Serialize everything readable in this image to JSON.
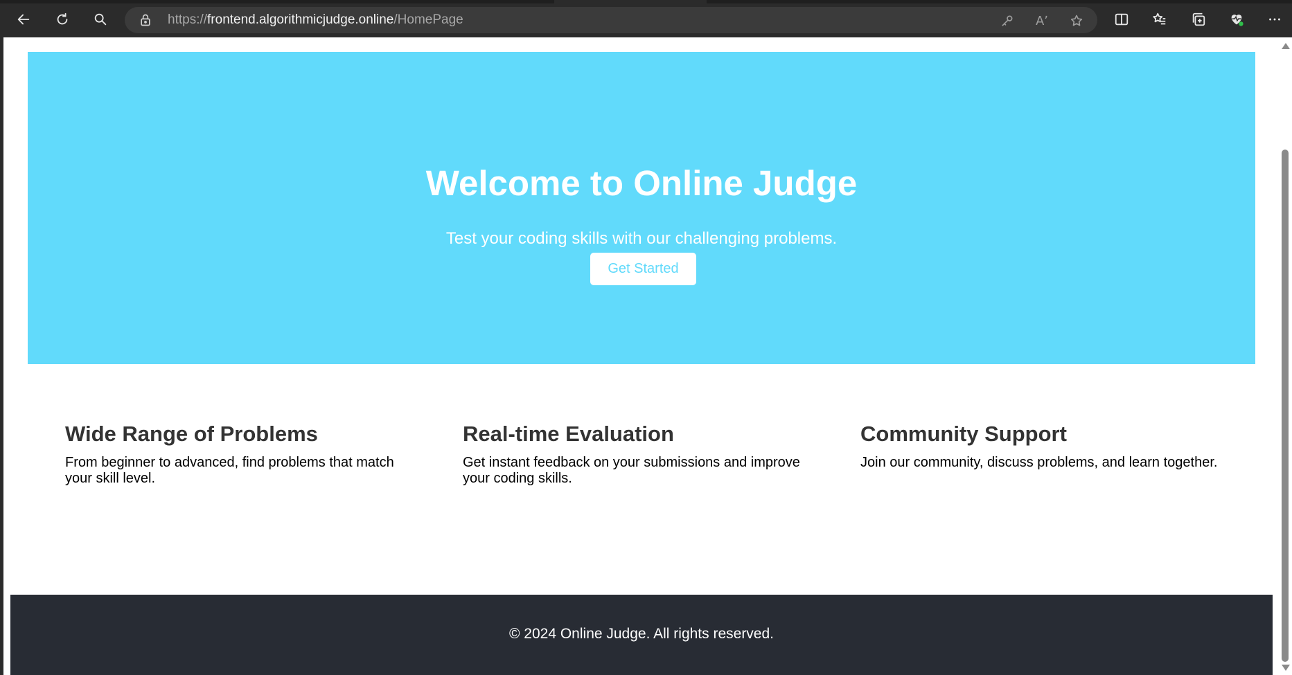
{
  "browser": {
    "url_scheme": "https://",
    "url_host": "frontend.algorithmicjudge.online",
    "url_path": "/HomePage",
    "read_aloud_glyph": "Aʼ"
  },
  "hero": {
    "title": "Welcome to Online Judge",
    "subtitle": "Test your coding skills with our challenging problems.",
    "cta_label": "Get Started",
    "background_color": "#61dafb"
  },
  "features": [
    {
      "title": "Wide Range of Problems",
      "description": "From beginner to advanced, find problems that match your skill level."
    },
    {
      "title": "Real-time Evaluation",
      "description": "Get instant feedback on your submissions and improve your coding skills."
    },
    {
      "title": "Community Support",
      "description": "Join our community, discuss problems, and learn together."
    }
  ],
  "footer": {
    "text": "© 2024 Online Judge. All rights reserved.",
    "background_color": "#282c34"
  }
}
